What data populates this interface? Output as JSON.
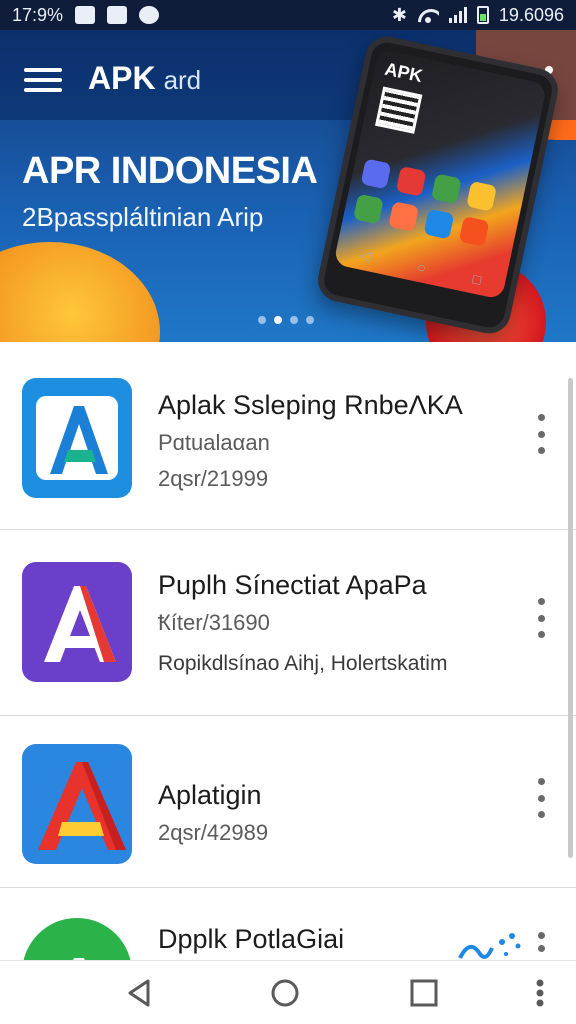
{
  "status_bar": {
    "left_text": "17:9%",
    "right_text": "19.6096",
    "icons": [
      "image-icon",
      "message-icon",
      "notification-icon",
      "bluetooth-icon",
      "wifi-icon",
      "signal-icon",
      "battery-icon"
    ]
  },
  "app_bar": {
    "title_main": "APK",
    "title_secondary": "ard",
    "menu_icon": "hamburger-menu-icon",
    "action_icon": "share-icon"
  },
  "banner": {
    "heading": "APR INDONESIA",
    "subheading": "2Bpasspláltinian Arip",
    "phone_text": "APK",
    "slides_total": 4,
    "active_slide": 1,
    "colors": {
      "deep_blue": "#123a7c",
      "blue": "#1f77c8",
      "orange": "#f08a1a",
      "red": "#d3181f"
    }
  },
  "apps": [
    {
      "title": "Aplak Ssleping RnbeΛKA",
      "subtitle": "Pɑtualaαan",
      "meta": "2ɋsr/21999",
      "icon": "blue-a-app-icon",
      "icon_color": "#1e8fe0"
    },
    {
      "title": "Puplh Sínectiat ApaPa",
      "subtitle": "Ҟíter/31690",
      "meta": "Ropikdlsínao Aihj, Holertskatim",
      "icon": "purple-a-app-icon",
      "icon_color": "#6a3fc9"
    },
    {
      "title": "Aplatigin",
      "subtitle": "2ɋsr/42989",
      "meta": "",
      "icon": "red-a-app-icon",
      "icon_color": "#2b86e0"
    },
    {
      "title": "Dpplk PotlaGiai",
      "subtitle": "",
      "meta": "",
      "icon": "green-a-app-icon",
      "icon_color": "#2bb34a"
    }
  ],
  "nav": {
    "back_icon": "back-icon",
    "home_icon": "home-icon",
    "recents_icon": "recents-icon",
    "more_icon": "more-icon"
  }
}
